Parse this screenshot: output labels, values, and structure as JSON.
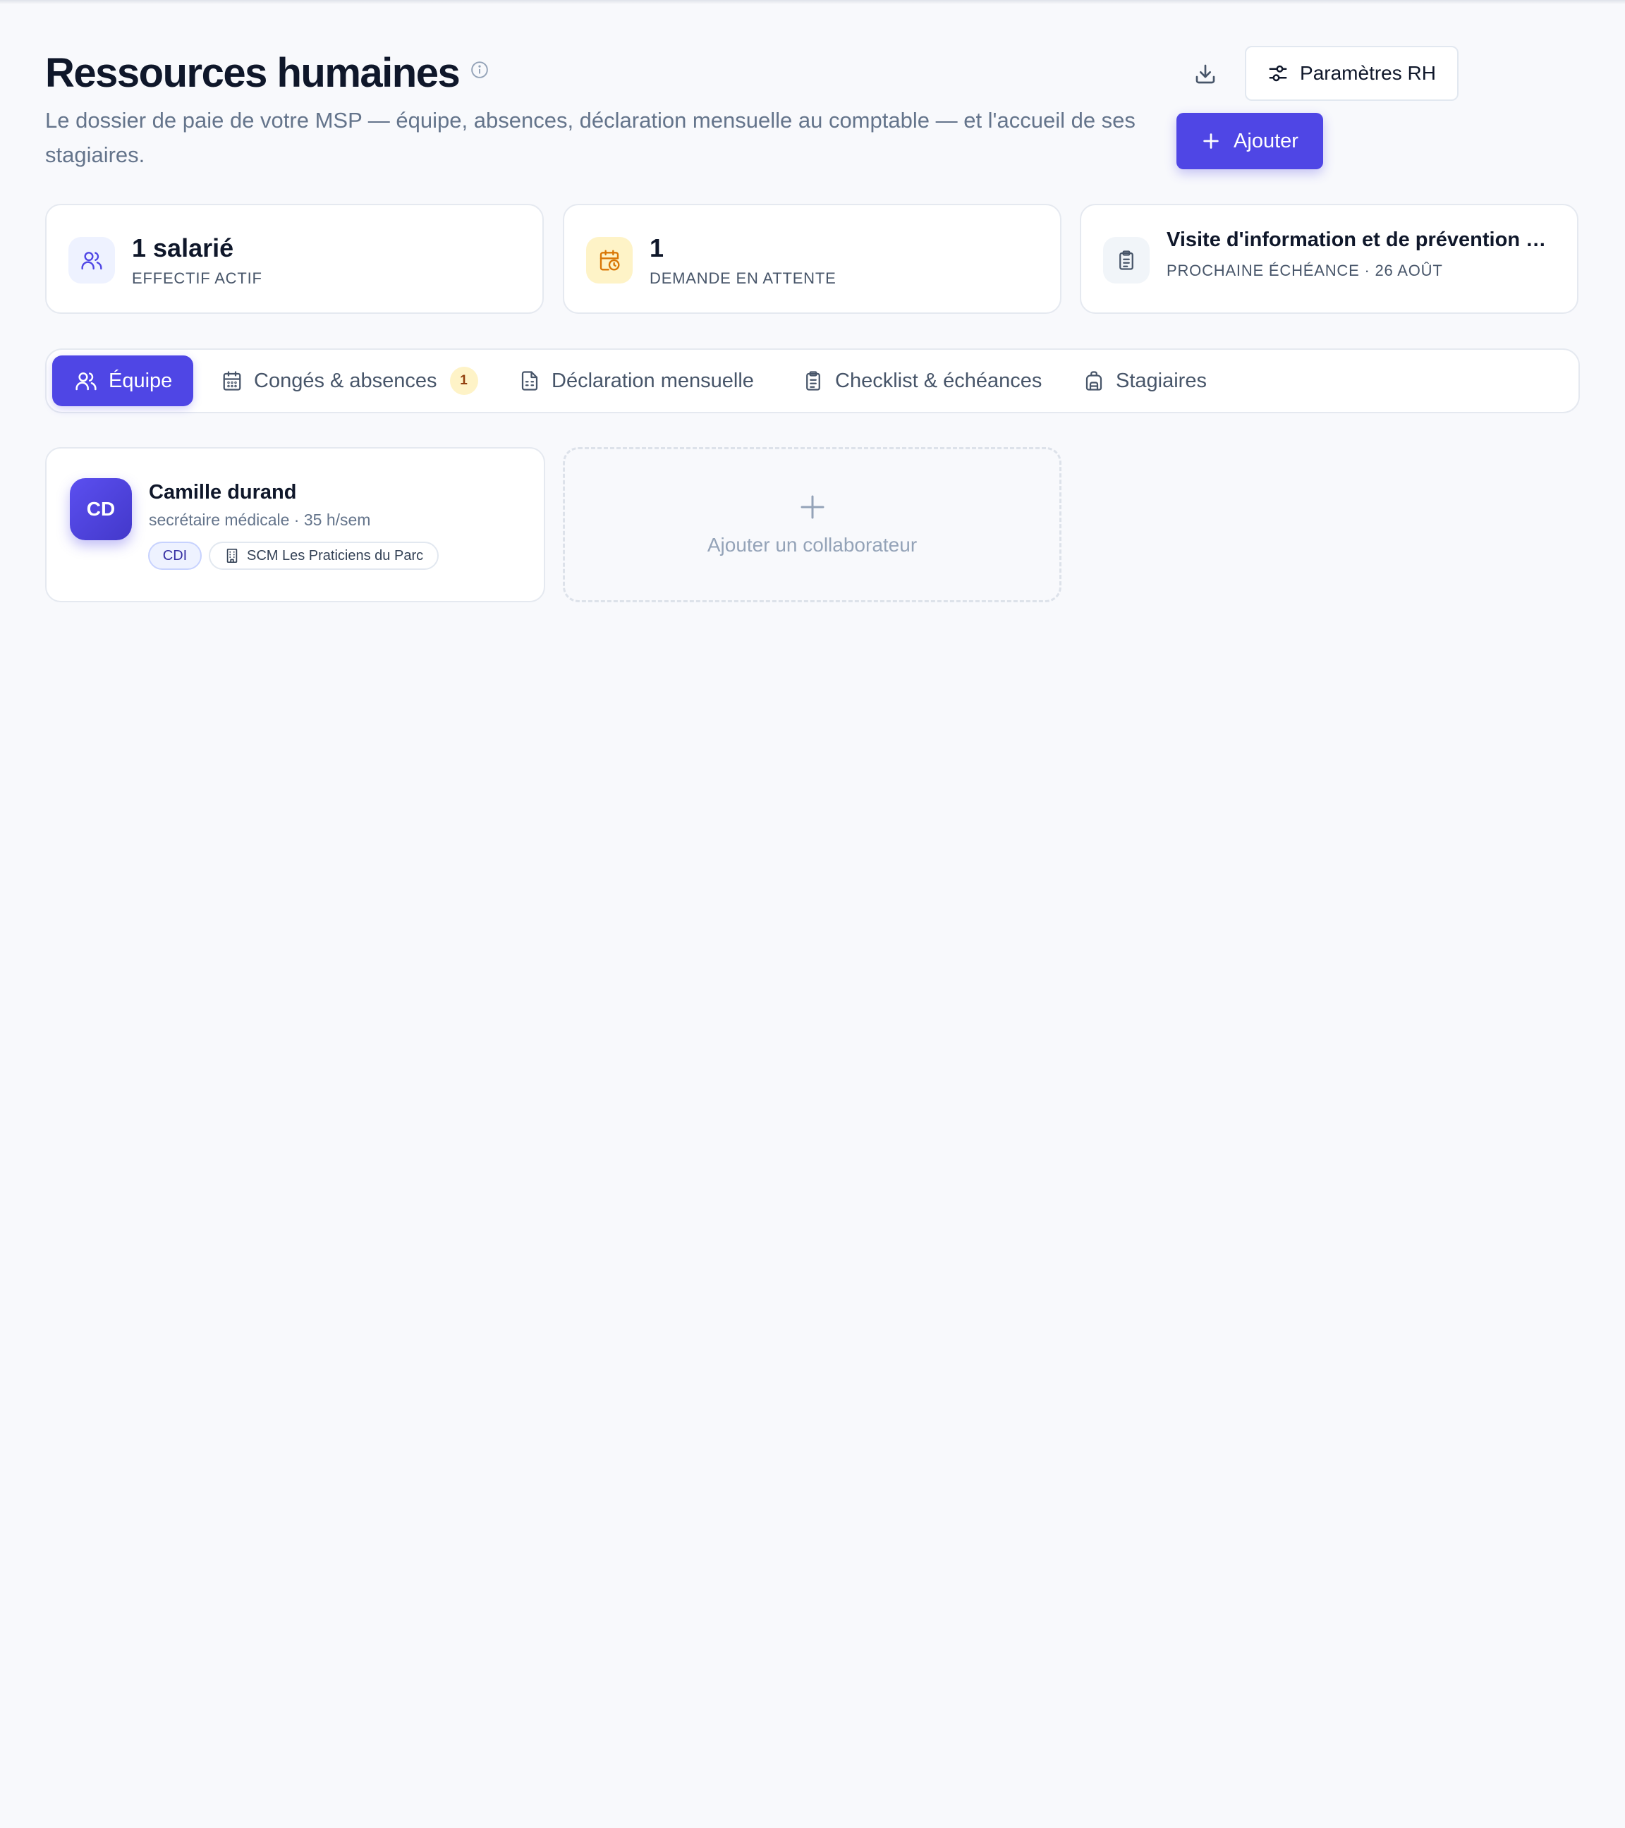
{
  "header": {
    "title": "Ressources humaines",
    "subtitle": "Le dossier de paie de votre MSP — équipe, absences, déclaration mensuelle au comptable — et l'accueil de ses stagiaires.",
    "params_label": "Paramètres RH",
    "add_label": "Ajouter"
  },
  "stats": [
    {
      "value": "1 salarié",
      "label": "EFFECTIF ACTIF",
      "icon": "users-icon"
    },
    {
      "value": "1",
      "label": "DEMANDE EN ATTENTE",
      "icon": "calendar-clock-icon"
    },
    {
      "value": "Visite d'information et de prévention — Camille durand",
      "label": "PROCHAINE ÉCHÉANCE · 26 AOÛT",
      "icon": "clipboard-icon"
    }
  ],
  "tabs": [
    {
      "label": "Équipe",
      "icon": "users-icon",
      "active": true
    },
    {
      "label": "Congés & absences",
      "icon": "calendar-icon",
      "badge": "1"
    },
    {
      "label": "Déclaration mensuelle",
      "icon": "file-spreadsheet-icon"
    },
    {
      "label": "Checklist & échéances",
      "icon": "clipboard-list-icon"
    },
    {
      "label": "Stagiaires",
      "icon": "backpack-icon"
    }
  ],
  "employees": [
    {
      "initials": "CD",
      "name": "Camille durand",
      "role": "secrétaire médicale · 35 h/sem",
      "contract": "CDI",
      "entity": "SCM Les Praticiens du Parc"
    }
  ],
  "add_collaborator_label": "Ajouter un collaborateur",
  "colors": {
    "accent": "#4f46e5",
    "background": "#f8f9fc",
    "badge_bg": "#fef3c7",
    "warning_icon": "#d97706"
  }
}
